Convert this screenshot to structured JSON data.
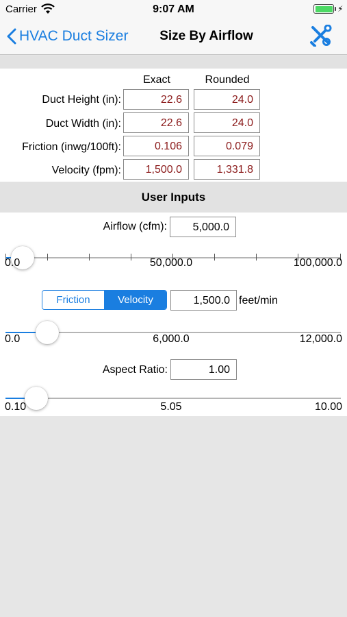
{
  "status_bar": {
    "carrier": "Carrier",
    "time": "9:07 AM"
  },
  "nav": {
    "back_label": "HVAC Duct Sizer",
    "title": "Size By Airflow"
  },
  "results": {
    "col_exact": "Exact",
    "col_rounded": "Rounded",
    "rows": [
      {
        "label": "Duct Height (in):",
        "exact": "22.6",
        "rounded": "24.0"
      },
      {
        "label": "Duct Width (in):",
        "exact": "22.6",
        "rounded": "24.0"
      },
      {
        "label": "Friction (inwg/100ft):",
        "exact": "0.106",
        "rounded": "0.079"
      },
      {
        "label": "Velocity (fpm):",
        "exact": "1,500.0",
        "rounded": "1,331.8"
      }
    ]
  },
  "user_inputs": {
    "title": "User Inputs",
    "airflow": {
      "label": "Airflow (cfm):",
      "value": "5,000.0",
      "slider": {
        "min_label": "0.0",
        "mid_label": "50,000.0",
        "max_label": "100,000.0",
        "fraction": 0.05
      }
    },
    "mode": {
      "options": [
        "Friction",
        "Velocity"
      ],
      "selected": "Velocity",
      "value": "1,500.0",
      "unit": "feet/min",
      "slider": {
        "min_label": "0.0",
        "mid_label": "6,000.0",
        "max_label": "12,000.0",
        "fraction": 0.125
      }
    },
    "aspect": {
      "label": "Aspect Ratio:",
      "value": "1.00",
      "slider": {
        "min_label": "0.10",
        "mid_label": "5.05",
        "max_label": "10.00",
        "fraction": 0.091
      }
    }
  },
  "colors": {
    "accent": "#1a7ee0",
    "result_text": "#8b1a1a"
  }
}
